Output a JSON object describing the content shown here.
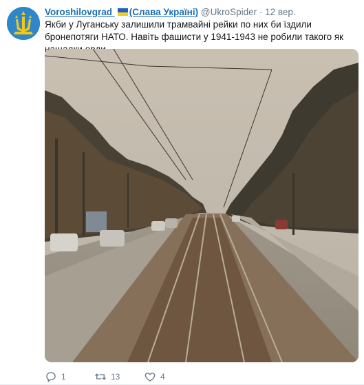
{
  "tweet": {
    "author_name": "Voroshilovgrad",
    "author_name_suffix": "(Слава Україні)",
    "handle": "@UkroSpider",
    "separator": "·",
    "time": "12 вер.",
    "text": "Якби у Луганську залишили трамвайні рейки по них би їздили бронепотяги НАТО. Навіть фашисти у 1941-1943 не робили такого як нащадки орди."
  },
  "actions": {
    "reply_count": "1",
    "retweet_count": "13",
    "like_count": "4"
  },
  "colors": {
    "link_name": "#1b6fb5",
    "muted": "#657786",
    "avatar_bg": "#2f86c8"
  },
  "icons": [
    "reply-icon",
    "retweet-icon",
    "like-icon",
    "ukraine-flag-icon",
    "trident-avatar-icon"
  ]
}
